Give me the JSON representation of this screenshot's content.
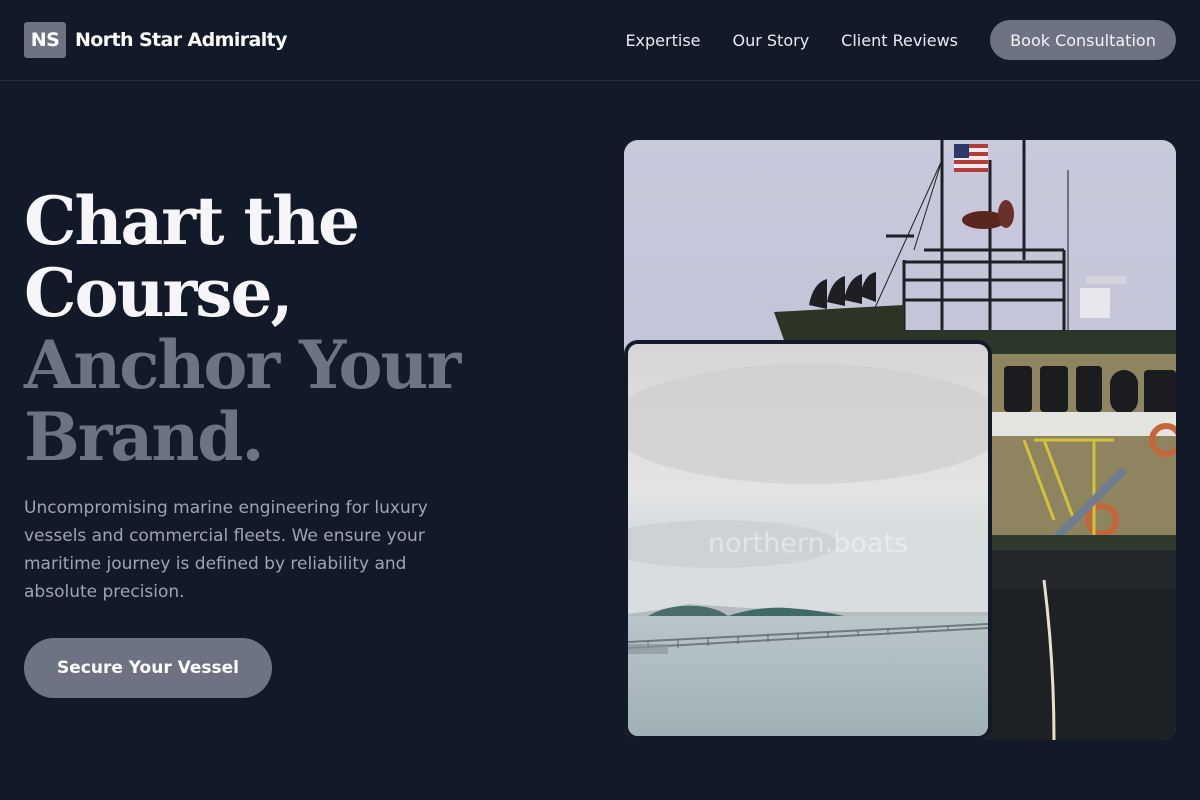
{
  "brand": {
    "mark": "NS",
    "name": "North Star Admiralty"
  },
  "nav": {
    "links": [
      "Expertise",
      "Our Story",
      "Client Reviews"
    ],
    "cta": "Book Consultation"
  },
  "hero": {
    "title_lines": [
      "Chart the",
      "Course,",
      "Anchor Your",
      "Brand."
    ],
    "description": "Uncompromising marine engineering for luxury vessels and commercial fleets. We ensure your maritime journey is defined by reliability and absolute precision.",
    "cta": "Secure Your Vessel"
  },
  "images": {
    "back": {
      "subject": "ship-superstructure-photo"
    },
    "front": {
      "subject": "calm-sea-pier-photo",
      "watermark": "northern.boats"
    }
  },
  "colors": {
    "background": "#121a29",
    "accent": "#6d7383",
    "heading_light": "#f6f6f8",
    "body_text": "#9fa4b2"
  }
}
